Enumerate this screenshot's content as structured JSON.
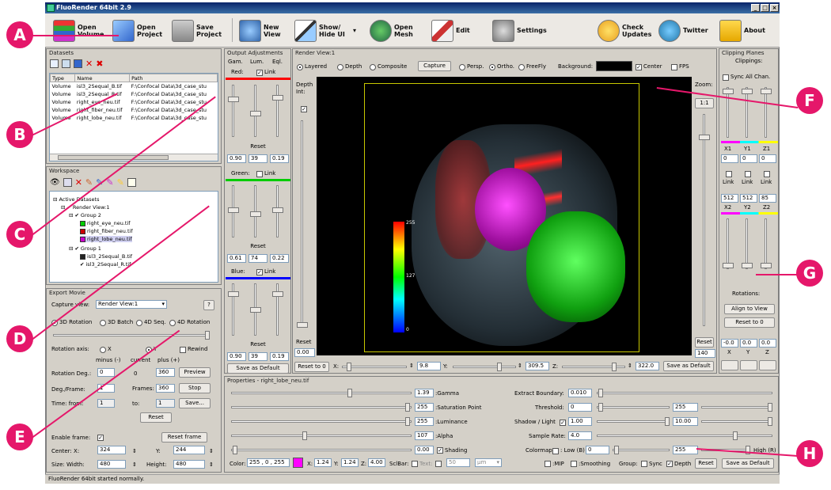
{
  "window": {
    "title": "FluoRender 64bit 2.9"
  },
  "toolbar": {
    "items": [
      {
        "label": "Open Volume",
        "icon": "books-icon"
      },
      {
        "label": "Open Project",
        "icon": "project-icon"
      },
      {
        "label": "Save Project",
        "icon": "floppy-icon"
      },
      {
        "label": "New View",
        "icon": "camera-icon"
      },
      {
        "label": "Show/ Hide UI",
        "icon": "pen-icon"
      },
      {
        "label": "Open Mesh",
        "icon": "globe-icon"
      },
      {
        "label": "Edit",
        "icon": "brush-icon"
      },
      {
        "label": "Settings",
        "icon": "gears-icon"
      },
      {
        "label": "Check Updates",
        "icon": "update-icon"
      },
      {
        "label": "Twitter",
        "icon": "bird-icon"
      },
      {
        "label": "About",
        "icon": "info-icon"
      }
    ]
  },
  "callouts": [
    "A",
    "B",
    "C",
    "D",
    "E",
    "F",
    "G",
    "H"
  ],
  "datasets": {
    "title": "Datasets",
    "columns": [
      "Type",
      "Name",
      "Path"
    ],
    "rows": [
      [
        "Volume",
        "isl3_2Sequal_B.tif",
        "F:\\Confocal Data\\3d_case_stu"
      ],
      [
        "Volume",
        "isl3_2Sequal_R.tif",
        "F:\\Confocal Data\\3d_case_stu"
      ],
      [
        "Volume",
        "right_eye_neu.tif",
        "F:\\Confocal Data\\3d_case_stu"
      ],
      [
        "Volume",
        "right_fiber_neu.tif",
        "F:\\Confocal Data\\3d_case_stu"
      ],
      [
        "Volume",
        "right_lobe_neu.tif",
        "F:\\Confocal Data\\3d_case_stu"
      ]
    ]
  },
  "workspace": {
    "title": "Workspace",
    "tree": [
      {
        "label": "Active Datasets",
        "indent": 0
      },
      {
        "label": "Render View:1",
        "indent": 1
      },
      {
        "label": "Group 2",
        "indent": 2
      },
      {
        "label": "right_eye_neu.tif",
        "indent": 3,
        "color": "#00cc00"
      },
      {
        "label": "right_fiber_neu.tif",
        "indent": 3,
        "color": "#cc0000"
      },
      {
        "label": "right_lobe_neu.tif",
        "indent": 3,
        "color": "#cc00cc"
      },
      {
        "label": "Group 1",
        "indent": 2
      },
      {
        "label": "isl3_2Sequal_B.tif",
        "indent": 3
      },
      {
        "label": "isl3_2Sequal_R.tif",
        "indent": 3
      }
    ]
  },
  "export": {
    "title": "Export Movie",
    "capture_view_label": "Capture view:",
    "capture_view_value": "Render View:1",
    "help": "?",
    "modes": [
      "3D Rotation",
      "3D Batch",
      "4D Seq.",
      "4D Rotation"
    ],
    "rotation_axis_label": "Rotation axis:",
    "axis_x": "X",
    "axis_y": "Y",
    "rewind": "Rewind",
    "minus_label": "minus (-)",
    "current_label": "current",
    "plus_label": "plus (+)",
    "rotation_deg_label": "Rotation Deg.:",
    "rot_minus": "0",
    "rot_current": "0",
    "rot_plus": "360",
    "preview": "Preview",
    "deg_frame_label": "Deg./Frame:",
    "deg_frame": "1",
    "frames_label": "Frames:",
    "frames": "360",
    "stop": "Stop",
    "time_from_label": "Time:  from:",
    "time_from": "1",
    "time_to_label": "to:",
    "time_to": "1",
    "save": "Save...",
    "reset": "Reset",
    "enable_frame": "Enable frame:",
    "reset_frame": "Reset frame",
    "center_label": "Center: X:",
    "center_x": "324",
    "y_label": "Y:",
    "center_y": "244",
    "size_label": "Size:  Width:",
    "width": "480",
    "height_label": "Height:",
    "height": "480"
  },
  "output": {
    "title": "Output Adjustments",
    "headers": [
      "Gam.",
      "Lum.",
      "Eql."
    ],
    "link": "Link",
    "reset": "Reset",
    "channels": [
      {
        "name": "Red:",
        "color": "#ff0000",
        "values": [
          "0.90",
          "39",
          "0.19"
        ]
      },
      {
        "name": "Green:",
        "color": "#00cc00",
        "values": [
          "0.61",
          "74",
          "0.22"
        ]
      },
      {
        "name": "Blue:",
        "color": "#0000ff",
        "values": [
          "0.90",
          "39",
          "0.19"
        ]
      }
    ],
    "save_default": "Save as Default"
  },
  "depth": {
    "label": "Depth Int:",
    "reset": "Reset",
    "value": "0.00"
  },
  "render_view": {
    "title": "Render View:1",
    "modes": [
      "Layered",
      "Depth",
      "Composite"
    ],
    "capture": "Capture",
    "proj": [
      "Persp.",
      "Ortho.",
      "FreeFly"
    ],
    "background_label": "Background:",
    "center": "Center",
    "fps": "FPS",
    "zoom_label": "Zoom:",
    "zoom_ratio": "1:1",
    "zoom_reset": "Reset",
    "zoom_value": "140",
    "reset_to_0": "Reset to 0",
    "x_label": "X:",
    "x_value": "9.8",
    "y_label": "Y:",
    "y_value": "309.5",
    "z_label": "Z:",
    "z_value": "322.0",
    "save_default": "Save as Default",
    "colorbar": [
      "255",
      "127",
      "0"
    ]
  },
  "clipping": {
    "title": "Clipping Planes",
    "clippings": "Clippings:",
    "sync": "Sync All Chan.",
    "axes_top": [
      "X1",
      "Y1",
      "Z1"
    ],
    "vals_top": [
      "0",
      "0",
      "0"
    ],
    "link": "Link",
    "vals_bottom": [
      "512",
      "512",
      "85"
    ],
    "axes_bottom": [
      "X2",
      "Y2",
      "Z2"
    ],
    "rotations": "Rotations:",
    "align": "Align to View",
    "reset0": "Reset to 0",
    "rot_vals": [
      "-0.0",
      "0.0",
      "0.0"
    ],
    "rot_axes": [
      "X",
      "Y",
      "Z"
    ]
  },
  "properties": {
    "title": "Properties - right_lobe_neu.tif",
    "left": [
      {
        "label": ":Gamma",
        "value": "1.39"
      },
      {
        "label": ":Saturation Point",
        "value": "255"
      },
      {
        "label": ":Luminance",
        "value": "255"
      },
      {
        "label": ":Alpha",
        "value": "107"
      },
      {
        "label": "",
        "value": "0.00"
      }
    ],
    "shading": "Shading",
    "color_label": "Color:",
    "color_value": "255 , 0 , 255",
    "swatch": "#ff00ff",
    "sx": "X:",
    "sx_val": "1.24",
    "sy": "Y:",
    "sy_val": "1.24",
    "sz": "Z:",
    "sz_val": "4.00",
    "scalebar": "SclBar:",
    "text_label": "Text:",
    "scale_val": "50",
    "unit": "µm",
    "extract_label": "Extract Boundary:",
    "extract_val": "0.010",
    "threshold_label": "Threshold:",
    "threshold_lo": "0",
    "threshold_hi": "255",
    "shadow_label": "Shadow / Light",
    "shadow_val": "1.00",
    "light_val": "10.00",
    "sample_label": "Sample Rate:",
    "sample_val": "4.0",
    "colormap_label": "Colormap",
    "low_label": ": Low (B)",
    "low_val": "0",
    "high_val": "255",
    "high_label": "High (R)",
    "mip": ":MIP",
    "smoothing": ":Smoothing",
    "group": "Group:",
    "sync": "Sync",
    "depth": "Depth",
    "reset": "Reset",
    "save_default": "Save as Default"
  },
  "status": "FluoRender 64bit started normally."
}
